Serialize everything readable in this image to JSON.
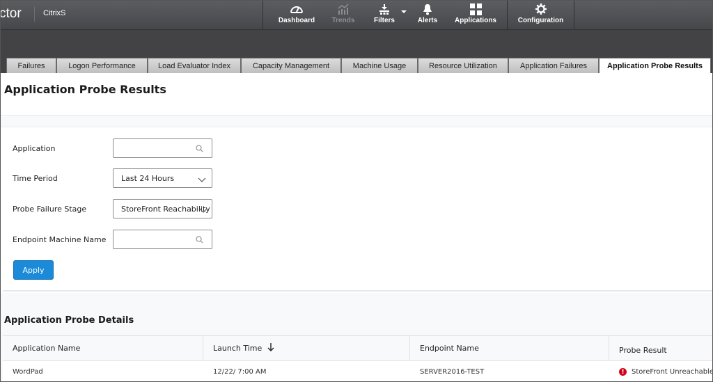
{
  "header": {
    "brand_fragment": "ctor",
    "site_name": "CitrixS",
    "nav": [
      {
        "label": "Dashboard",
        "icon": "speedometer-icon",
        "disabled": false
      },
      {
        "label": "Trends",
        "icon": "trend-chart-icon",
        "disabled": true
      },
      {
        "label": "Filters",
        "icon": "filter-network-icon",
        "disabled": false,
        "has_dropdown": true
      },
      {
        "label": "Alerts",
        "icon": "bell-icon",
        "disabled": false
      },
      {
        "label": "Applications",
        "icon": "grid-icon",
        "disabled": false
      },
      {
        "label": "Configuration",
        "icon": "gear-icon",
        "disabled": false
      }
    ]
  },
  "tabs": [
    {
      "label": "Failures",
      "active": false
    },
    {
      "label": "Logon Performance",
      "active": false
    },
    {
      "label": "Load Evaluator Index",
      "active": false
    },
    {
      "label": "Capacity Management",
      "active": false
    },
    {
      "label": "Machine Usage",
      "active": false
    },
    {
      "label": "Resource Utilization",
      "active": false
    },
    {
      "label": "Application Failures",
      "active": false
    },
    {
      "label": "Application Probe Results",
      "active": true
    }
  ],
  "page": {
    "title": "Application Probe Results"
  },
  "form": {
    "application": {
      "label": "Application",
      "value": "",
      "icon": "search-icon"
    },
    "time_period": {
      "label": "Time Period",
      "value": "Last 24 Hours",
      "icon": "chevron-down-icon"
    },
    "probe_failure_stage": {
      "label": "Probe Failure Stage",
      "value": "StoreFront Reachability",
      "icon": "chevron-down-icon"
    },
    "endpoint_machine_name": {
      "label": "Endpoint Machine Name",
      "value": "",
      "icon": "search-icon"
    },
    "apply_label": "Apply"
  },
  "details": {
    "title": "Application Probe Details",
    "columns": [
      "Application Name",
      "Launch Time",
      "Endpoint Name",
      "Probe Result"
    ],
    "sort_column": "Launch Time",
    "sort_direction": "descending",
    "rows": [
      {
        "application_name": "WordPad",
        "launch_time": "12/22/ 7:00 AM",
        "endpoint_name": "SERVER2016-TEST",
        "probe_result": "StoreFront Unreachable",
        "status": "error"
      }
    ]
  },
  "colors": {
    "topbar": "#4f5054",
    "accent": "#1b8ad8",
    "error": "#d0021b"
  }
}
